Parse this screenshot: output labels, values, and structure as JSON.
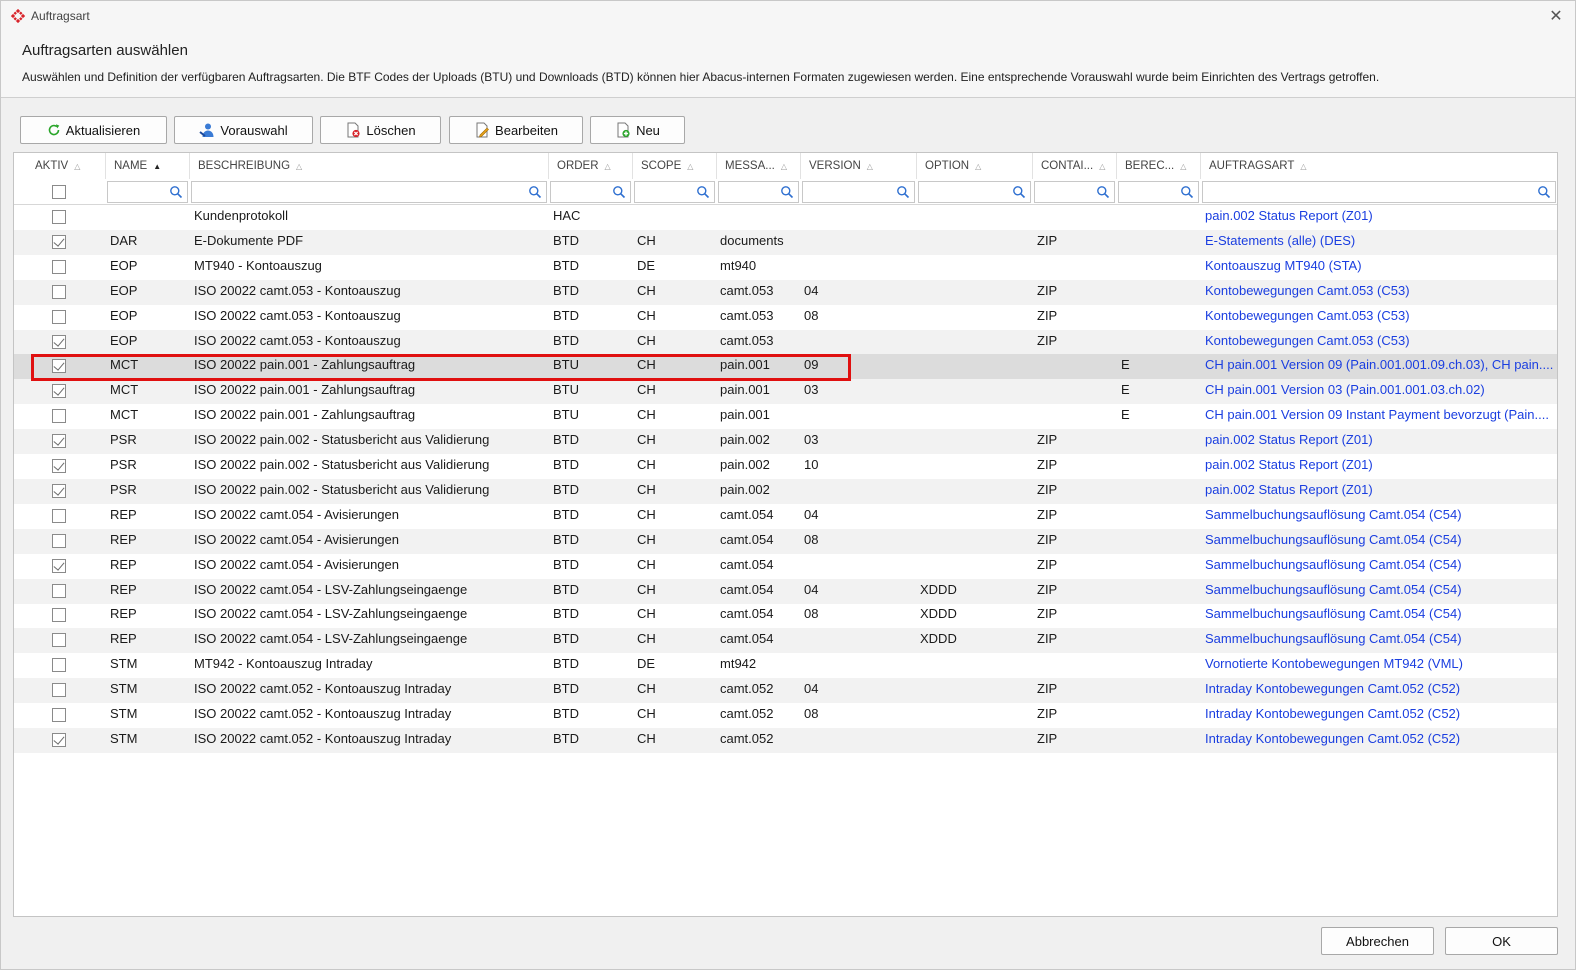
{
  "window": {
    "title": "Auftragsart",
    "header_title": "Auftragsarten auswählen",
    "header_description": "Auswählen und Definition der verfügbaren Auftragsarten. Die BTF Codes der Uploads (BTU) und Downloads (BTD) können hier Abacus-internen Formaten zugewiesen werden. Eine entsprechende Vorauswahl wurde beim Einrichten des Vertrags getroffen."
  },
  "toolbar": {
    "refresh_label": "Aktualisieren",
    "preselect_label": "Vorauswahl",
    "delete_label": "Löschen",
    "edit_label": "Bearbeiten",
    "new_label": "Neu"
  },
  "columns": {
    "aktiv": "AKTIV",
    "name": "NAME",
    "beschreibung": "BESCHREIBUNG",
    "order": "ORDER",
    "scope": "SCOPE",
    "message": "MESSA...",
    "version": "VERSION",
    "option": "OPTION",
    "container": "CONTAI...",
    "berechtigung": "BEREC...",
    "auftragsart": "AUFTRAGSART"
  },
  "rows": [
    {
      "aktiv": false,
      "name": "",
      "beschreibung": "Kundenprotokoll",
      "order": "HAC",
      "scope": "",
      "message": "",
      "version": "",
      "option": "",
      "container": "",
      "berechtigung": "",
      "auftragsart": "pain.002 Status Report (Z01)"
    },
    {
      "aktiv": true,
      "name": "DAR",
      "beschreibung": "E-Dokumente PDF",
      "order": "BTD",
      "scope": "CH",
      "message": "documents",
      "version": "",
      "option": "",
      "container": "ZIP",
      "berechtigung": "",
      "auftragsart": "E-Statements (alle) (DES)"
    },
    {
      "aktiv": false,
      "name": "EOP",
      "beschreibung": "MT940 - Kontoauszug",
      "order": "BTD",
      "scope": "DE",
      "message": "mt940",
      "version": "",
      "option": "",
      "container": "",
      "berechtigung": "",
      "auftragsart": "Kontoauszug MT940 (STA)"
    },
    {
      "aktiv": false,
      "name": "EOP",
      "beschreibung": "ISO 20022 camt.053 - Kontoauszug",
      "order": "BTD",
      "scope": "CH",
      "message": "camt.053",
      "version": "04",
      "option": "",
      "container": "ZIP",
      "berechtigung": "",
      "auftragsart": "Kontobewegungen Camt.053 (C53)"
    },
    {
      "aktiv": false,
      "name": "EOP",
      "beschreibung": "ISO 20022 camt.053 - Kontoauszug",
      "order": "BTD",
      "scope": "CH",
      "message": "camt.053",
      "version": "08",
      "option": "",
      "container": "ZIP",
      "berechtigung": "",
      "auftragsart": "Kontobewegungen Camt.053 (C53)"
    },
    {
      "aktiv": true,
      "name": "EOP",
      "beschreibung": "ISO 20022 camt.053 - Kontoauszug",
      "order": "BTD",
      "scope": "CH",
      "message": "camt.053",
      "version": "",
      "option": "",
      "container": "ZIP",
      "berechtigung": "",
      "auftragsart": "Kontobewegungen Camt.053 (C53)"
    },
    {
      "aktiv": true,
      "name": "MCT",
      "beschreibung": "ISO 20022 pain.001 - Zahlungsauftrag",
      "order": "BTU",
      "scope": "CH",
      "message": "pain.001",
      "version": "09",
      "option": "",
      "container": "",
      "berechtigung": "E",
      "auftragsart": "CH pain.001 Version 09  (Pain.001.001.09.ch.03), CH pain...."
    },
    {
      "aktiv": true,
      "name": "MCT",
      "beschreibung": "ISO 20022 pain.001 - Zahlungsauftrag",
      "order": "BTU",
      "scope": "CH",
      "message": "pain.001",
      "version": "03",
      "option": "",
      "container": "",
      "berechtigung": "E",
      "auftragsart": "CH pain.001 Version 03 (Pain.001.001.03.ch.02)"
    },
    {
      "aktiv": false,
      "name": "MCT",
      "beschreibung": "ISO 20022 pain.001 - Zahlungsauftrag",
      "order": "BTU",
      "scope": "CH",
      "message": "pain.001",
      "version": "",
      "option": "",
      "container": "",
      "berechtigung": "E",
      "auftragsart": "CH pain.001 Version 09 Instant Payment bevorzugt (Pain...."
    },
    {
      "aktiv": true,
      "name": "PSR",
      "beschreibung": "ISO 20022 pain.002 - Statusbericht aus Validierung",
      "order": "BTD",
      "scope": "CH",
      "message": "pain.002",
      "version": "03",
      "option": "",
      "container": "ZIP",
      "berechtigung": "",
      "auftragsart": "pain.002 Status Report (Z01)"
    },
    {
      "aktiv": true,
      "name": "PSR",
      "beschreibung": "ISO 20022 pain.002 - Statusbericht aus Validierung",
      "order": "BTD",
      "scope": "CH",
      "message": "pain.002",
      "version": "10",
      "option": "",
      "container": "ZIP",
      "berechtigung": "",
      "auftragsart": "pain.002 Status Report (Z01)"
    },
    {
      "aktiv": true,
      "name": "PSR",
      "beschreibung": "ISO 20022 pain.002 - Statusbericht aus Validierung",
      "order": "BTD",
      "scope": "CH",
      "message": "pain.002",
      "version": "",
      "option": "",
      "container": "ZIP",
      "berechtigung": "",
      "auftragsart": "pain.002 Status Report (Z01)"
    },
    {
      "aktiv": false,
      "name": "REP",
      "beschreibung": "ISO 20022 camt.054 - Avisierungen",
      "order": "BTD",
      "scope": "CH",
      "message": "camt.054",
      "version": "04",
      "option": "",
      "container": "ZIP",
      "berechtigung": "",
      "auftragsart": "Sammelbuchungsauflösung Camt.054 (C54)"
    },
    {
      "aktiv": false,
      "name": "REP",
      "beschreibung": "ISO 20022 camt.054 - Avisierungen",
      "order": "BTD",
      "scope": "CH",
      "message": "camt.054",
      "version": "08",
      "option": "",
      "container": "ZIP",
      "berechtigung": "",
      "auftragsart": "Sammelbuchungsauflösung Camt.054 (C54)"
    },
    {
      "aktiv": true,
      "name": "REP",
      "beschreibung": "ISO 20022 camt.054 - Avisierungen",
      "order": "BTD",
      "scope": "CH",
      "message": "camt.054",
      "version": "",
      "option": "",
      "container": "ZIP",
      "berechtigung": "",
      "auftragsart": "Sammelbuchungsauflösung Camt.054 (C54)"
    },
    {
      "aktiv": false,
      "name": "REP",
      "beschreibung": "ISO 20022 camt.054 - LSV-Zahlungseingaenge",
      "order": "BTD",
      "scope": "CH",
      "message": "camt.054",
      "version": "04",
      "option": "XDDD",
      "container": "ZIP",
      "berechtigung": "",
      "auftragsart": "Sammelbuchungsauflösung Camt.054 (C54)"
    },
    {
      "aktiv": false,
      "name": "REP",
      "beschreibung": "ISO 20022 camt.054 - LSV-Zahlungseingaenge",
      "order": "BTD",
      "scope": "CH",
      "message": "camt.054",
      "version": "08",
      "option": "XDDD",
      "container": "ZIP",
      "berechtigung": "",
      "auftragsart": "Sammelbuchungsauflösung Camt.054 (C54)"
    },
    {
      "aktiv": false,
      "name": "REP",
      "beschreibung": "ISO 20022 camt.054 - LSV-Zahlungseingaenge",
      "order": "BTD",
      "scope": "CH",
      "message": "camt.054",
      "version": "",
      "option": "XDDD",
      "container": "ZIP",
      "berechtigung": "",
      "auftragsart": "Sammelbuchungsauflösung Camt.054 (C54)"
    },
    {
      "aktiv": false,
      "name": "STM",
      "beschreibung": "MT942 - Kontoauszug Intraday",
      "order": "BTD",
      "scope": "DE",
      "message": "mt942",
      "version": "",
      "option": "",
      "container": "",
      "berechtigung": "",
      "auftragsart": "Vornotierte Kontobewegungen MT942 (VML)"
    },
    {
      "aktiv": false,
      "name": "STM",
      "beschreibung": "ISO 20022 camt.052 - Kontoauszug Intraday",
      "order": "BTD",
      "scope": "CH",
      "message": "camt.052",
      "version": "04",
      "option": "",
      "container": "ZIP",
      "berechtigung": "",
      "auftragsart": "Intraday Kontobewegungen Camt.052 (C52)"
    },
    {
      "aktiv": false,
      "name": "STM",
      "beschreibung": "ISO 20022 camt.052 - Kontoauszug Intraday",
      "order": "BTD",
      "scope": "CH",
      "message": "camt.052",
      "version": "08",
      "option": "",
      "container": "ZIP",
      "berechtigung": "",
      "auftragsart": "Intraday Kontobewegungen Camt.052 (C52)"
    },
    {
      "aktiv": true,
      "name": "STM",
      "beschreibung": "ISO 20022 camt.052 - Kontoauszug Intraday",
      "order": "BTD",
      "scope": "CH",
      "message": "camt.052",
      "version": "",
      "option": "",
      "container": "ZIP",
      "berechtigung": "",
      "auftragsart": "Intraday Kontobewegungen Camt.052 (C52)"
    }
  ],
  "selected_row": 6,
  "footer": {
    "cancel_label": "Abbrechen",
    "ok_label": "OK"
  },
  "colors": {
    "link": "#1a3ee0",
    "highlight_border": "#e01010",
    "selected_row": "#dcdcdc",
    "alt_row": "#f2f2f2"
  },
  "icons": {
    "app": "auftragsart-app-icon",
    "refresh": "refresh-icon",
    "preselect": "preselect-user-icon",
    "delete": "delete-doc-icon",
    "edit": "edit-doc-icon",
    "new": "new-doc-icon",
    "filter": "search-icon",
    "close": "close-icon"
  }
}
